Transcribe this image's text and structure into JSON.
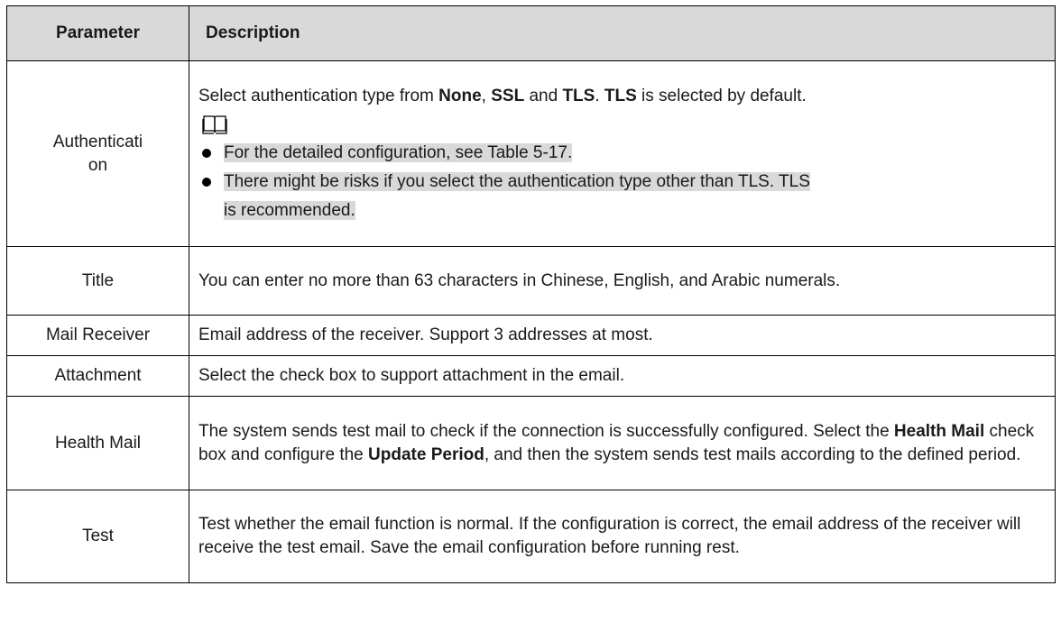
{
  "header": {
    "parameter": "Parameter",
    "description": "Description"
  },
  "rows": {
    "authentication": {
      "name_line1": "Authenticati",
      "name_line2": "on",
      "desc_p1": "Select authentication type from ",
      "desc_none": "None",
      "desc_sep1": ", ",
      "desc_ssl": "SSL",
      "desc_and": " and ",
      "desc_tls": "TLS",
      "desc_dot": ". ",
      "desc_tls2": "TLS",
      "desc_end": " is selected by default.",
      "note_icon": "book-icon",
      "bullet1": "For the detailed configuration, see Table 5-17.",
      "bullet2_line1": "There might be risks if you select the authentication type other than TLS. TLS",
      "bullet2_line2": "is recommended."
    },
    "title": {
      "name": "Title",
      "desc": "You can enter no more than 63 characters in Chinese, English, and Arabic numerals."
    },
    "mail_receiver": {
      "name": "Mail Receiver",
      "desc": "Email address of the receiver. Support 3 addresses at most."
    },
    "attachment": {
      "name": "Attachment",
      "desc": "Select the check box to support attachment in the email."
    },
    "health_mail": {
      "name": "Health Mail",
      "desc_p1": "The system sends test mail to check if the connection is successfully configured. Select the ",
      "desc_b1": "Health Mail",
      "desc_p2": " check box and configure the ",
      "desc_b2": "Update Period",
      "desc_p3": ", and then the system sends test mails according to the defined period."
    },
    "test": {
      "name": "Test",
      "desc": "Test whether the email function is normal. If the configuration is correct, the email address of the receiver will receive the test email. Save the email configuration before running rest."
    }
  }
}
